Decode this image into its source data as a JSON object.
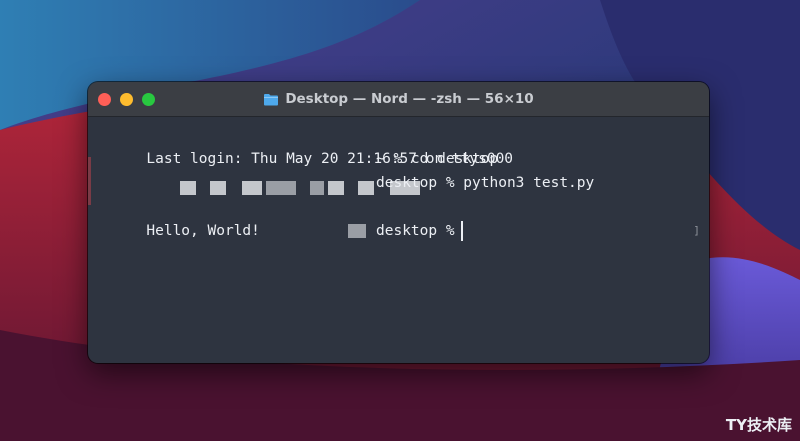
{
  "window": {
    "title": "Desktop — Nord — -zsh — 56×10"
  },
  "terminal": {
    "line1": "Last login: Thu May 20 21:16:57 on ttys000",
    "line2_cmd": "~ % cd desktop",
    "line3_cmd": "desktop % python3 test.py",
    "line4": "Hello, World!",
    "line5_prompt": "desktop %"
  },
  "watermark": "TY技术库",
  "colors": {
    "terminal_bg": "#2e3440",
    "terminal_fg": "#eceff4",
    "titlebar_bg": "#3b3e44"
  }
}
